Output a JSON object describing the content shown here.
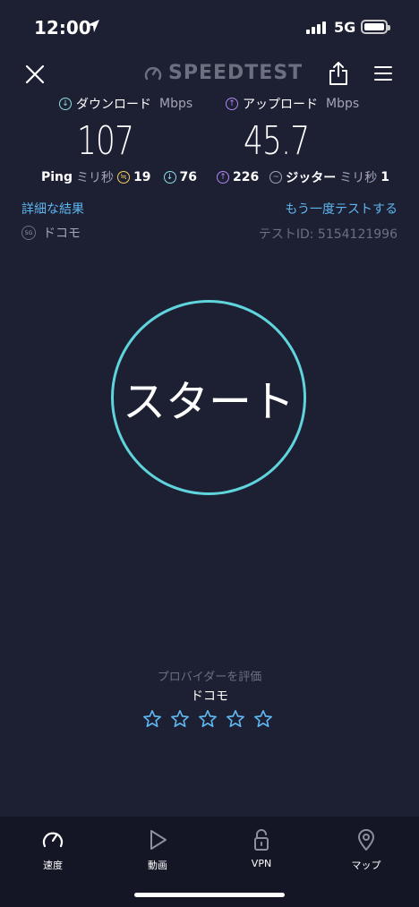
{
  "status_bar": {
    "time": "12:00",
    "network": "5G"
  },
  "header": {
    "logo": "SPEEDTEST"
  },
  "download": {
    "label": "ダウンロード",
    "unit": "Mbps",
    "value": "107"
  },
  "upload": {
    "label": "アップロード",
    "unit": "Mbps",
    "value": "45.7"
  },
  "ping": {
    "label": "Ping",
    "unit": "ミリ秒",
    "idle": "19",
    "download": "76",
    "upload": "226",
    "jitter_label": "ジッター",
    "jitter_unit": "ミリ秒",
    "jitter": "1"
  },
  "links": {
    "details": "詳細な結果",
    "retest": "もう一度テストする"
  },
  "provider": {
    "badge": "5G",
    "name": "ドコモ",
    "test_id": "テストID: 5154121996"
  },
  "start_label": "スタート",
  "rating": {
    "title": "プロバイダーを評価",
    "provider": "ドコモ",
    "stars": 0,
    "max_stars": 5
  },
  "tabs": [
    {
      "label": "速度",
      "icon": "speedometer-icon"
    },
    {
      "label": "動画",
      "icon": "play-icon"
    },
    {
      "label": "VPN",
      "icon": "lock-icon"
    },
    {
      "label": "マップ",
      "icon": "map-pin-icon"
    }
  ],
  "colors": {
    "background": "#1d1f33",
    "download": "#8be0e4",
    "upload": "#b287f3",
    "link": "#5eb6ef",
    "start_ring": "#5fd4dc",
    "idle_ping": "#f4d35e"
  }
}
